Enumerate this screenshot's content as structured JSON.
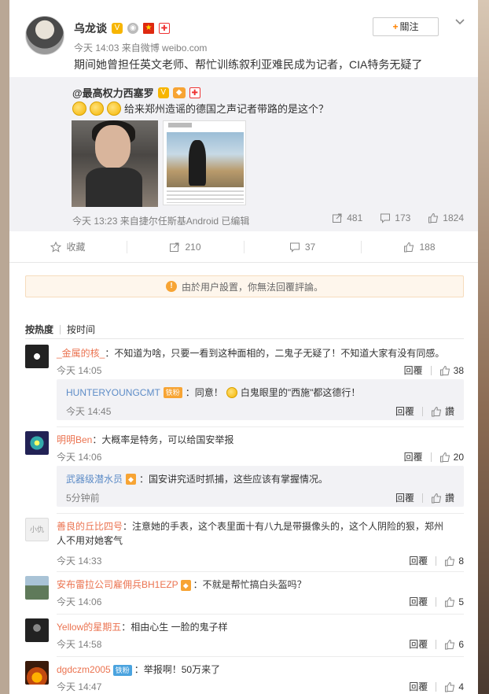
{
  "post": {
    "author": "乌龙谈",
    "time": "今天 14:03",
    "source": "来自微博 weibo.com",
    "text": "期间她曾担任英文老师、帮忙训练叙利亚难民成为记者，CIA特务无疑了",
    "follow_label": "關注",
    "follow_plus": "+"
  },
  "repost": {
    "at_author": "@最高权力西塞罗",
    "text": "给来郑州造谣的德国之声记者带路的是这个？",
    "meta": "今天 13:23 来自捷尔任斯基Android  已编辑",
    "forwards": "481",
    "comments": "173",
    "likes": "1824"
  },
  "actions": {
    "favorite": "收藏",
    "forward": "210",
    "comment": "37",
    "like": "188"
  },
  "comments_section": {
    "notice": "由於用户設置，你無法回覆評論。",
    "tab_hot": "按热度",
    "tab_time": "按时间",
    "reply_label": "回覆",
    "items": [
      {
        "user": "_金属的核_",
        "text": "：不知道为啥，只要一看到这种面相的，二鬼子无疑了！不知道大家有没有同感。",
        "time": "今天 14:05",
        "likes": "38"
      },
      {
        "user": "HUNTERYOUNGCMT",
        "badge": "铁粉",
        "text": "：同意！",
        "text2": "白鬼眼里的\"西施\"都这德行！",
        "time": "今天 14:45",
        "likes": "讚"
      },
      {
        "user": "明明Ben",
        "text": "：大概率是特务，可以给国安举报",
        "time": "今天 14:06",
        "likes": "20"
      },
      {
        "user": "武器级潜水员",
        "text": "：国安讲究适时抓捕，这些应该有掌握情况。",
        "time": "5分钟前",
        "likes": "讚"
      },
      {
        "user": "善良的丘比四号",
        "text": "：注意她的手表，这个表里面十有八九是带摄像头的，这个人阴险的狠，郑州人不用对她客气",
        "time": "今天 14:33",
        "likes": "8"
      },
      {
        "user": "安布雷拉公司雇佣兵BH1EZP",
        "text": "：不就是帮忙搞白头盔吗？",
        "time": "今天 14:06",
        "likes": "5"
      },
      {
        "user": "Yellow的星期五",
        "text": "：相由心生 一脸的鬼子样",
        "time": "今天 14:58",
        "likes": "6"
      },
      {
        "user": "dgdczm2005",
        "badge": "铁粉",
        "text": "：举报啊！50万来了",
        "time": "今天 14:47",
        "likes": "4"
      }
    ]
  },
  "colors": {
    "accent": "#ff8200",
    "link": "#eb7350",
    "blue_link": "#5d8cc7",
    "repost_bg": "#f2f2f5"
  }
}
